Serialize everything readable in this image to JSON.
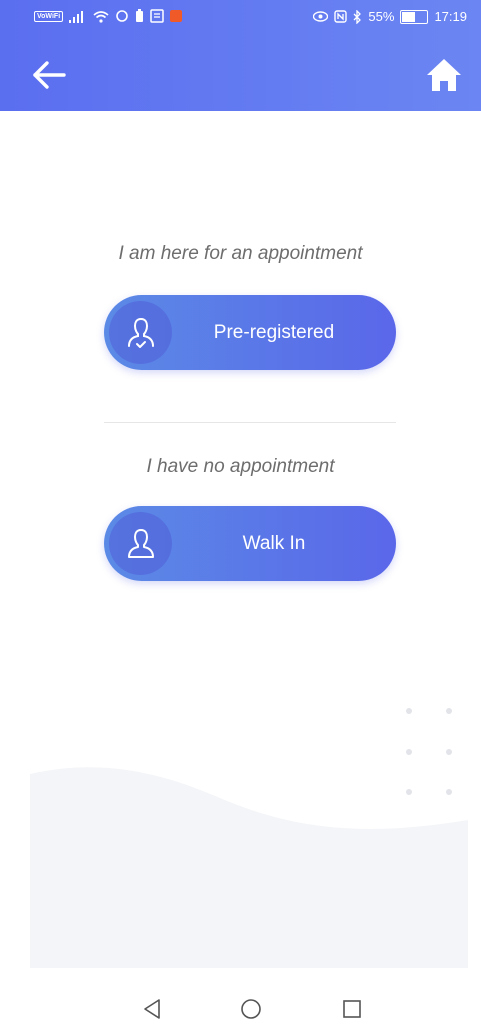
{
  "status_bar": {
    "left_badges": [
      "VoWiFi"
    ],
    "battery_percent": "55%",
    "battery_level": 0.55,
    "time": "17:19",
    "colors": {
      "notification_square": "#f05a28"
    }
  },
  "app_bar": {
    "back_icon": "arrow-left-icon",
    "home_icon": "home-icon",
    "gradient": [
      "#5a6ef0",
      "#6b86f2"
    ]
  },
  "main": {
    "appointment_label": "I am here for an appointment",
    "pre_registered_button": {
      "label": "Pre-registered",
      "icon": "user-check-icon"
    },
    "no_appointment_label": "I have no appointment",
    "walk_in_button": {
      "label": "Walk In",
      "icon": "user-icon"
    },
    "button_gradient": [
      "#5b8ae6",
      "#5a67e9"
    ]
  },
  "nav_bar": {
    "buttons": [
      "back-triangle-icon",
      "home-circle-icon",
      "recents-square-icon"
    ]
  }
}
